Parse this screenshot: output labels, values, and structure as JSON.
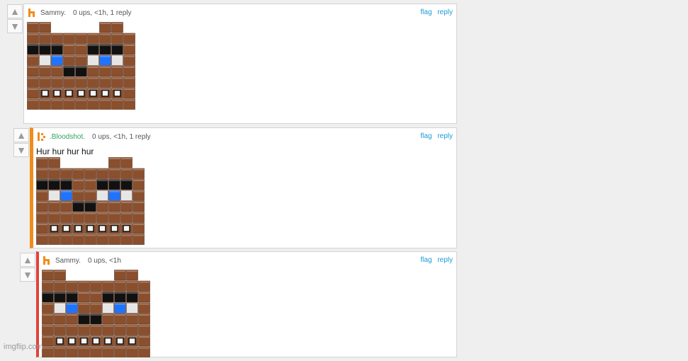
{
  "comments": [
    {
      "username": "Sammy.",
      "meta": "0 ups, <1h, 1 reply",
      "flag": "flag",
      "reply": "reply",
      "text": ""
    },
    {
      "username": ".Bloodshot.",
      "meta": "0 ups, <1h, 1 reply",
      "flag": "flag",
      "reply": "reply",
      "text": "Hur hur hur hur"
    },
    {
      "username": "Sammy.",
      "meta": "0 ups, <1h",
      "flag": "flag",
      "reply": "reply",
      "text": ""
    }
  ],
  "watermark": "imgflip.com",
  "colors": {
    "brown": "#8a4f2d",
    "blue": "#1f74ff",
    "black": "#111111",
    "white": "#f0f0f0",
    "link": "#1c9bd6",
    "orange": "#f08c1c",
    "red": "#e0423a"
  },
  "icons": {
    "upvote": "up-arrow-icon",
    "downvote": "down-arrow-icon",
    "avatar": "orange-pixel-avatar-icon"
  }
}
